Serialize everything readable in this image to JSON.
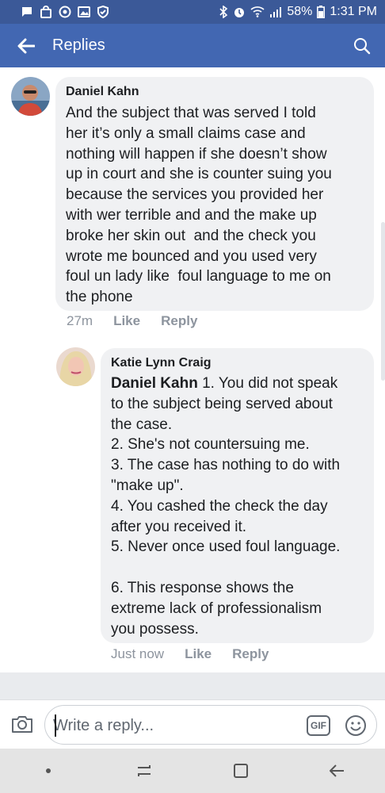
{
  "status_bar": {
    "battery": "58%",
    "time": "1:31 PM"
  },
  "header": {
    "title": "Replies"
  },
  "comments": [
    {
      "author": "Daniel Kahn",
      "text": "And the subject that was served I told\nher it’s only a small claims case and\nnothing will happen if she doesn’t show\nup in court and she is counter suing you\nbecause the services you provided her\nwith wer terrible and and the make up\nbroke her skin out  and the check you\nwrote me bounced and you used very\nfoul un lady like  foul language to me on\nthe phone",
      "time": "27m",
      "like": "Like",
      "reply": "Reply"
    },
    {
      "author": "Katie Lynn Craig",
      "tag": "Daniel Kahn",
      "text": " 1. You did not speak\nto the subject being served about\nthe case.\n2. She's not countersuing me.\n3. The case has nothing to do with\n\"make up\".\n4. You cashed the check the day\nafter you received it.\n5. Never once used foul language.\n\n6. This response shows the\nextreme lack of professionalism\nyou possess.",
      "time": "Just now",
      "like": "Like",
      "reply": "Reply"
    }
  ],
  "composer": {
    "placeholder": "Write a reply...",
    "gif_label": "GIF"
  }
}
